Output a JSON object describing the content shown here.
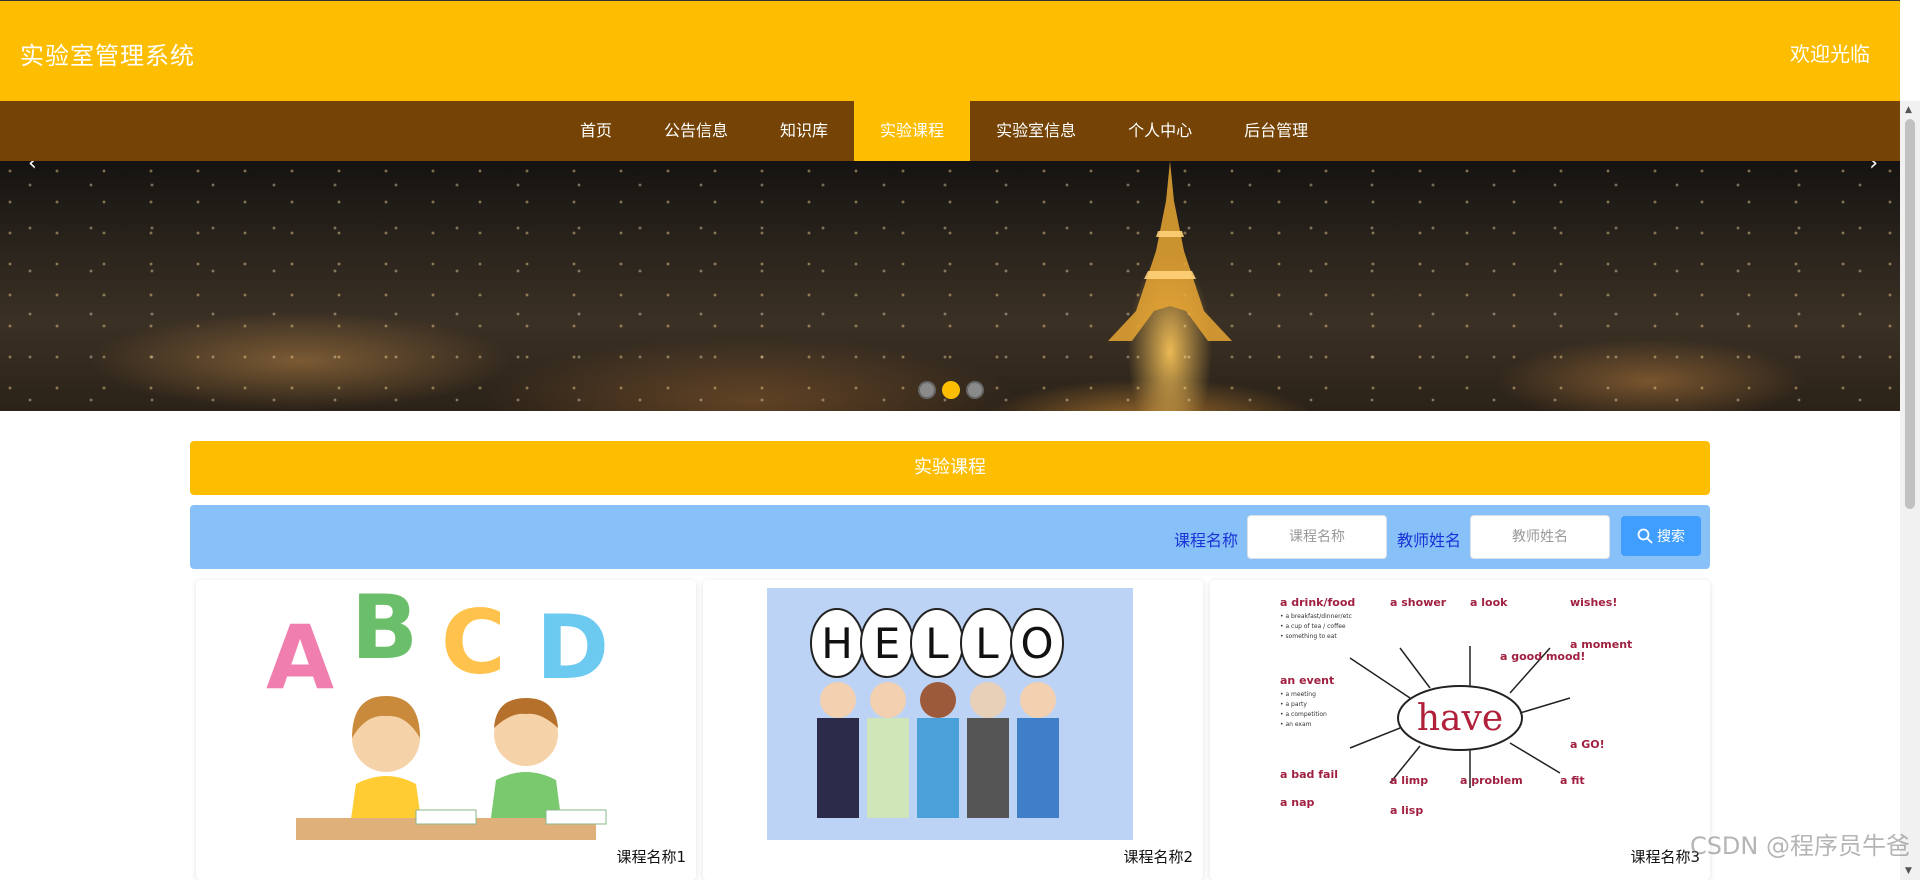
{
  "header": {
    "title": "实验室管理系统",
    "welcome": "欢迎光临"
  },
  "nav": {
    "items": [
      "首页",
      "公告信息",
      "知识库",
      "实验课程",
      "实验室信息",
      "个人中心",
      "后台管理"
    ],
    "active": "实验课程"
  },
  "banner": {
    "prev_icon": "chevron-left-icon",
    "next_icon": "chevron-right-icon",
    "slide_count": 3,
    "active_slide": 2
  },
  "section": {
    "title": "实验课程"
  },
  "search": {
    "course_label": "课程名称",
    "course_placeholder": "课程名称",
    "teacher_label": "教师姓名",
    "teacher_placeholder": "教师姓名",
    "button_label": "搜索",
    "button_icon": "search-icon"
  },
  "courses": [
    {
      "name": "课程名称1"
    },
    {
      "name": "课程名称2"
    },
    {
      "name": "课程名称3"
    }
  ],
  "watermark": "CSDN @程序员牛爸",
  "colors": {
    "header": "#fdbe02",
    "nav": "#744305",
    "search_bar": "#87c1f7",
    "button": "#409eff"
  }
}
